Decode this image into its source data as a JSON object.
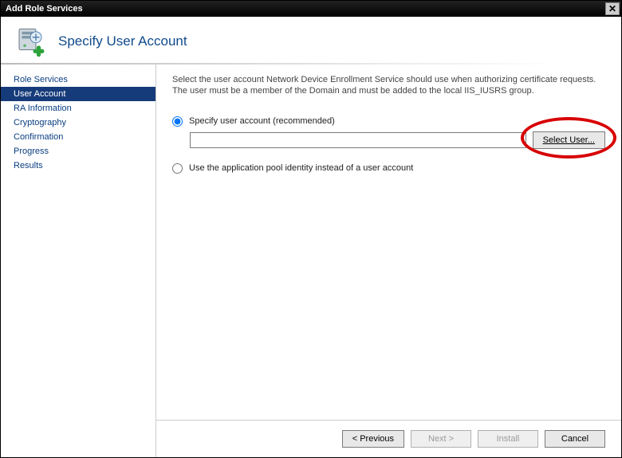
{
  "window": {
    "title": "Add Role Services"
  },
  "header": {
    "title": "Specify User Account"
  },
  "sidebar": {
    "items": [
      {
        "label": "Role Services"
      },
      {
        "label": "User Account"
      },
      {
        "label": "RA Information"
      },
      {
        "label": "Cryptography"
      },
      {
        "label": "Confirmation"
      },
      {
        "label": "Progress"
      },
      {
        "label": "Results"
      }
    ],
    "selected_index": 1
  },
  "content": {
    "description": "Select the user account Network Device Enrollment Service should use when authorizing certificate requests. The user must be a member of the Domain and must be added to the local IIS_IUSRS group.",
    "option_specify": "Specify user account (recommended)",
    "option_app_pool": "Use the application pool identity instead of a user account",
    "user_value": "",
    "select_user_label": "Select User..."
  },
  "footer": {
    "previous": "< Previous",
    "next": "Next >",
    "install": "Install",
    "cancel": "Cancel"
  }
}
